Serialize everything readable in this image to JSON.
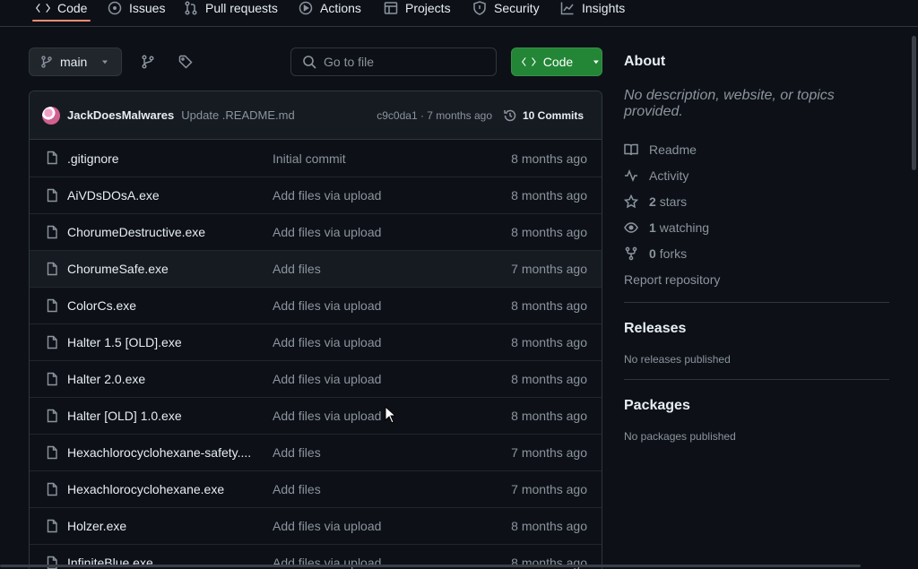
{
  "tabs": [
    "Code",
    "Issues",
    "Pull requests",
    "Actions",
    "Projects",
    "Security",
    "Insights"
  ],
  "toolbar": {
    "branch": "main",
    "search_placeholder": "Go to file",
    "code_label": "Code"
  },
  "commit": {
    "author": "JackDoesMalwares",
    "message": "Update .README.md",
    "meta": "c9c0da1 · 7 months ago",
    "commits_label": "10 Commits"
  },
  "files": [
    {
      "name": ".gitignore",
      "message": "Initial commit",
      "date": "8 months ago"
    },
    {
      "name": "AiVDsDOsA.exe",
      "message": "Add files via upload",
      "date": "8 months ago"
    },
    {
      "name": "ChorumeDestructive.exe",
      "message": "Add files via upload",
      "date": "8 months ago"
    },
    {
      "name": "ChorumeSafe.exe",
      "message": "Add files",
      "date": "7 months ago"
    },
    {
      "name": "ColorCs.exe",
      "message": "Add files via upload",
      "date": "8 months ago"
    },
    {
      "name": "Halter 1.5 [OLD].exe",
      "message": "Add files via upload",
      "date": "8 months ago"
    },
    {
      "name": "Halter 2.0.exe",
      "message": "Add files via upload",
      "date": "8 months ago"
    },
    {
      "name": "Halter [OLD] 1.0.exe",
      "message": "Add files via upload",
      "date": "8 months ago"
    },
    {
      "name": "Hexachlorocyclohexane-safety....",
      "message": "Add files",
      "date": "7 months ago"
    },
    {
      "name": "Hexachlorocyclohexane.exe",
      "message": "Add files",
      "date": "7 months ago"
    },
    {
      "name": "Holzer.exe",
      "message": "Add files via upload",
      "date": "8 months ago"
    },
    {
      "name": "InfiniteBlue.exe",
      "message": "Add files via upload",
      "date": "8 months ago"
    }
  ],
  "about": {
    "title": "About",
    "description": "No description, website, or topics provided.",
    "readme": "Readme",
    "activity": "Activity",
    "stars_count": "2",
    "stars_label": "stars",
    "watching_count": "1",
    "watching_label": "watching",
    "forks_count": "0",
    "forks_label": "forks",
    "report": "Report repository"
  },
  "releases": {
    "title": "Releases",
    "empty": "No releases published"
  },
  "packages": {
    "title": "Packages",
    "empty": "No packages published"
  },
  "colors": {
    "accent_green": "#238636",
    "tab_underline": "#fd8c73",
    "background": "#0d1117"
  }
}
